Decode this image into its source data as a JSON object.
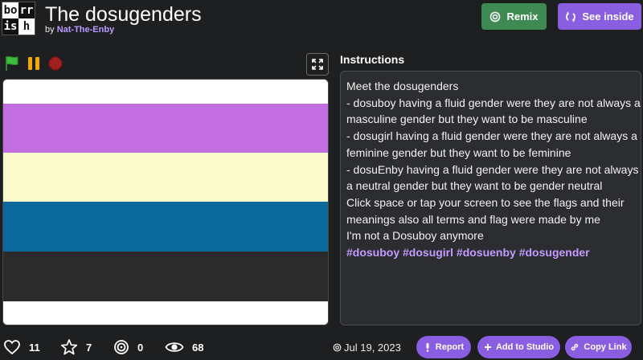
{
  "header": {
    "thumbnail_text": [
      "bo",
      "rr",
      "is",
      "h"
    ],
    "title": "The dosugenders",
    "by_prefix": "by",
    "author": "Nat-The-Enby",
    "remix_label": "Remix",
    "see_inside_label": "See inside"
  },
  "stage": {
    "flag_stripes": [
      "#ffffff",
      "#c26ee0",
      "#fdfccc",
      "#0b6a9b",
      "#2b2b2b",
      "#ffffff"
    ]
  },
  "instructions": {
    "heading": "Instructions",
    "lines": [
      "Meet the dosugenders",
      "- dosuboy having a fluid gender were they are not always a",
      "masculine gender but they want to be masculine",
      "- dosugirl having a fluid gender were they are not always a",
      "feminine gender but they want to be feminine",
      "- dosuEnby having a fluid gender were they are not always",
      "a neutral gender but they want to be gender neutral",
      "Click space or tap your screen to see the flags and their",
      "meanings also all terms and flag were made by me",
      "I'm not a Dosuboy anymore"
    ],
    "tags": [
      "#dosuboy",
      "#dosugirl",
      "#dosuenby",
      "#dosugender"
    ]
  },
  "stats": {
    "loves": "11",
    "favorites": "7",
    "remixes": "0",
    "views": "68"
  },
  "footer": {
    "date": "Jul 19, 2023",
    "report_label": "Report",
    "add_to_studio_label": "Add to Studio",
    "copy_link_label": "Copy Link"
  },
  "colors": {
    "remix_button": "#3f8a53",
    "accent_purple": "#8a5ee0",
    "author_link": "#b89cff",
    "tag_color": "#c49bff"
  }
}
